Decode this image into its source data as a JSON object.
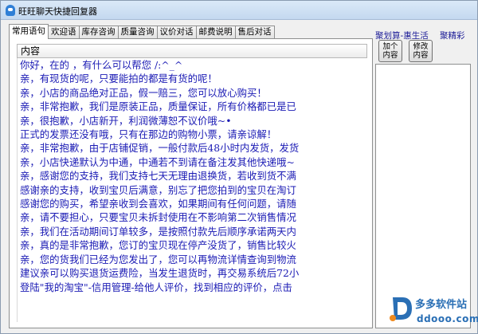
{
  "window": {
    "title": "旺旺聊天快捷回复器"
  },
  "tabs": [
    {
      "label": "常用语句",
      "active": true
    },
    {
      "label": "欢迎语"
    },
    {
      "label": "库存咨询"
    },
    {
      "label": "质量咨询"
    },
    {
      "label": "议价对话"
    },
    {
      "label": "邮费说明"
    },
    {
      "label": "售后对话"
    }
  ],
  "list": {
    "header": "内容",
    "items": [
      "你好，在的 ，有什么可以帮您 /:^_^",
      "亲，有现货的呢，只要能拍的都是有货的呢！",
      "亲，小店的商品绝对正品，假一赔三，您可以放心购买！",
      "亲，非常抱歉，我们是原装正品，质量保证，所有价格都已是已",
      "亲，很抱歉，小店新开，利润微薄恕不议价哦~•",
      "正式的发票还没有哦，只有在那边的购物小票，请亲谅解！",
      "亲，非常抱歉，由于店铺促销，一般付款后48小时内发货，发货",
      "亲，小店快递默认为中通，中通若不到请在备注发其他快递哦~",
      "亲，感谢您的支持，我们支持七天无理由退换货，若收到货不满",
      "感谢亲的支持，收到宝贝后满意，别忘了把您拍到的宝贝在淘订",
      "感谢您的购买，希望亲收到会喜欢，如果期间有任何问题，请随",
      "亲，请不要担心，只要宝贝未拆封使用在不影响第二次销售情况",
      "亲，我们在活动期间订单较多，是按照付款先后顺序承诺两天内",
      "亲，真的是非常抱歉，您订的宝贝现在停产没货了，销售比较火",
      "亲，您的货我们已经为您发出了，您可以再物流详情查询到物流",
      "建议亲可以购买退货运费险，当发生退货时，再交易系统后72小",
      "登陆\"我的淘宝\"-信用管理-给他人评价，找到相应的评价，点击"
    ]
  },
  "side": {
    "link_a": "聚划算-惠生活",
    "link_b": "聚精彩",
    "add_line1": "加个",
    "add_line2": "内容",
    "edit_line1": "修改",
    "edit_line2": "内容"
  },
  "watermark": {
    "name": "多多软件站",
    "url": "ddooo.com"
  }
}
